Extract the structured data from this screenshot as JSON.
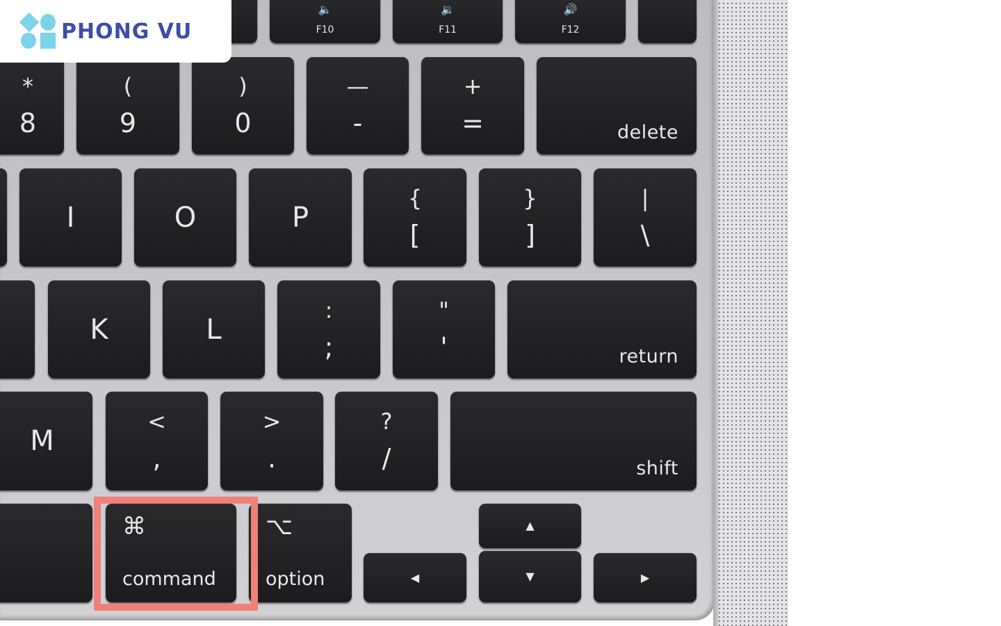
{
  "logo": {
    "text": "PHONG VU",
    "brand_color": "#3a4fa8",
    "mark_color": "#7dd3ec"
  },
  "highlight": {
    "target": "command",
    "color": "#f08078"
  },
  "keys": [
    {
      "name": "key-partial-top",
      "top": "",
      "bottom": "",
      "style": "one"
    },
    {
      "name": "key-f10",
      "top": "🔈",
      "bottom": "F10",
      "style": "fn",
      "icon": "volume-mute-icon"
    },
    {
      "name": "key-f11",
      "top": "🔉",
      "bottom": "F11",
      "style": "fn",
      "icon": "volume-down-icon"
    },
    {
      "name": "key-f12",
      "top": "🔊",
      "bottom": "F12",
      "style": "fn",
      "icon": "volume-up-icon"
    },
    {
      "name": "key-power",
      "top": "",
      "bottom": "",
      "style": "one"
    },
    {
      "name": "key-8",
      "top": "*",
      "bottom": "8",
      "style": "two"
    },
    {
      "name": "key-9",
      "top": "(",
      "bottom": "9",
      "style": "two"
    },
    {
      "name": "key-0",
      "top": ")",
      "bottom": "0",
      "style": "two"
    },
    {
      "name": "key-minus",
      "top": "—",
      "bottom": "-",
      "style": "two"
    },
    {
      "name": "key-equals",
      "top": "+",
      "bottom": "=",
      "style": "two"
    },
    {
      "name": "key-delete",
      "top": "delete",
      "bottom": "",
      "style": "word"
    },
    {
      "name": "key-partial-u",
      "top": "",
      "bottom": "",
      "style": "one"
    },
    {
      "name": "key-i",
      "top": "I",
      "bottom": "",
      "style": "one"
    },
    {
      "name": "key-o",
      "top": "O",
      "bottom": "",
      "style": "one"
    },
    {
      "name": "key-p",
      "top": "P",
      "bottom": "",
      "style": "one"
    },
    {
      "name": "key-left-bracket",
      "top": "{",
      "bottom": "[",
      "style": "two"
    },
    {
      "name": "key-right-bracket",
      "top": "}",
      "bottom": "]",
      "style": "two"
    },
    {
      "name": "key-backslash",
      "top": "|",
      "bottom": "\\",
      "style": "two"
    },
    {
      "name": "key-partial-j",
      "top": "",
      "bottom": "",
      "style": "one"
    },
    {
      "name": "key-k",
      "top": "K",
      "bottom": "",
      "style": "one"
    },
    {
      "name": "key-l",
      "top": "L",
      "bottom": "",
      "style": "one"
    },
    {
      "name": "key-semicolon",
      "top": ":",
      "bottom": ";",
      "style": "two"
    },
    {
      "name": "key-quote",
      "top": "\"",
      "bottom": "'",
      "style": "two"
    },
    {
      "name": "key-return",
      "top": "return",
      "bottom": "",
      "style": "word"
    },
    {
      "name": "key-m",
      "top": "M",
      "bottom": "",
      "style": "one"
    },
    {
      "name": "key-comma",
      "top": "<",
      "bottom": ",",
      "style": "two"
    },
    {
      "name": "key-period",
      "top": ">",
      "bottom": ".",
      "style": "two"
    },
    {
      "name": "key-slash",
      "top": "?",
      "bottom": "/",
      "style": "two"
    },
    {
      "name": "key-shift",
      "top": "shift",
      "bottom": "",
      "style": "word"
    },
    {
      "name": "key-partial-bottom",
      "top": "",
      "bottom": "",
      "style": "one"
    },
    {
      "name": "key-command",
      "top": "⌘",
      "bottom": "command",
      "style": "mod",
      "icon": "command-icon"
    },
    {
      "name": "key-option",
      "top": "⌥",
      "bottom": "option",
      "style": "mod",
      "icon": "option-icon"
    },
    {
      "name": "key-arrow-left",
      "top": "◀",
      "bottom": "",
      "style": "arrow",
      "icon": "arrow-left-icon"
    },
    {
      "name": "key-arrow-up",
      "top": "▲",
      "bottom": "",
      "style": "arrow",
      "icon": "arrow-up-icon"
    },
    {
      "name": "key-arrow-down",
      "top": "▼",
      "bottom": "",
      "style": "arrow",
      "icon": "arrow-down-icon"
    },
    {
      "name": "key-arrow-right",
      "top": "▶",
      "bottom": "",
      "style": "arrow",
      "icon": "arrow-right-icon"
    }
  ]
}
